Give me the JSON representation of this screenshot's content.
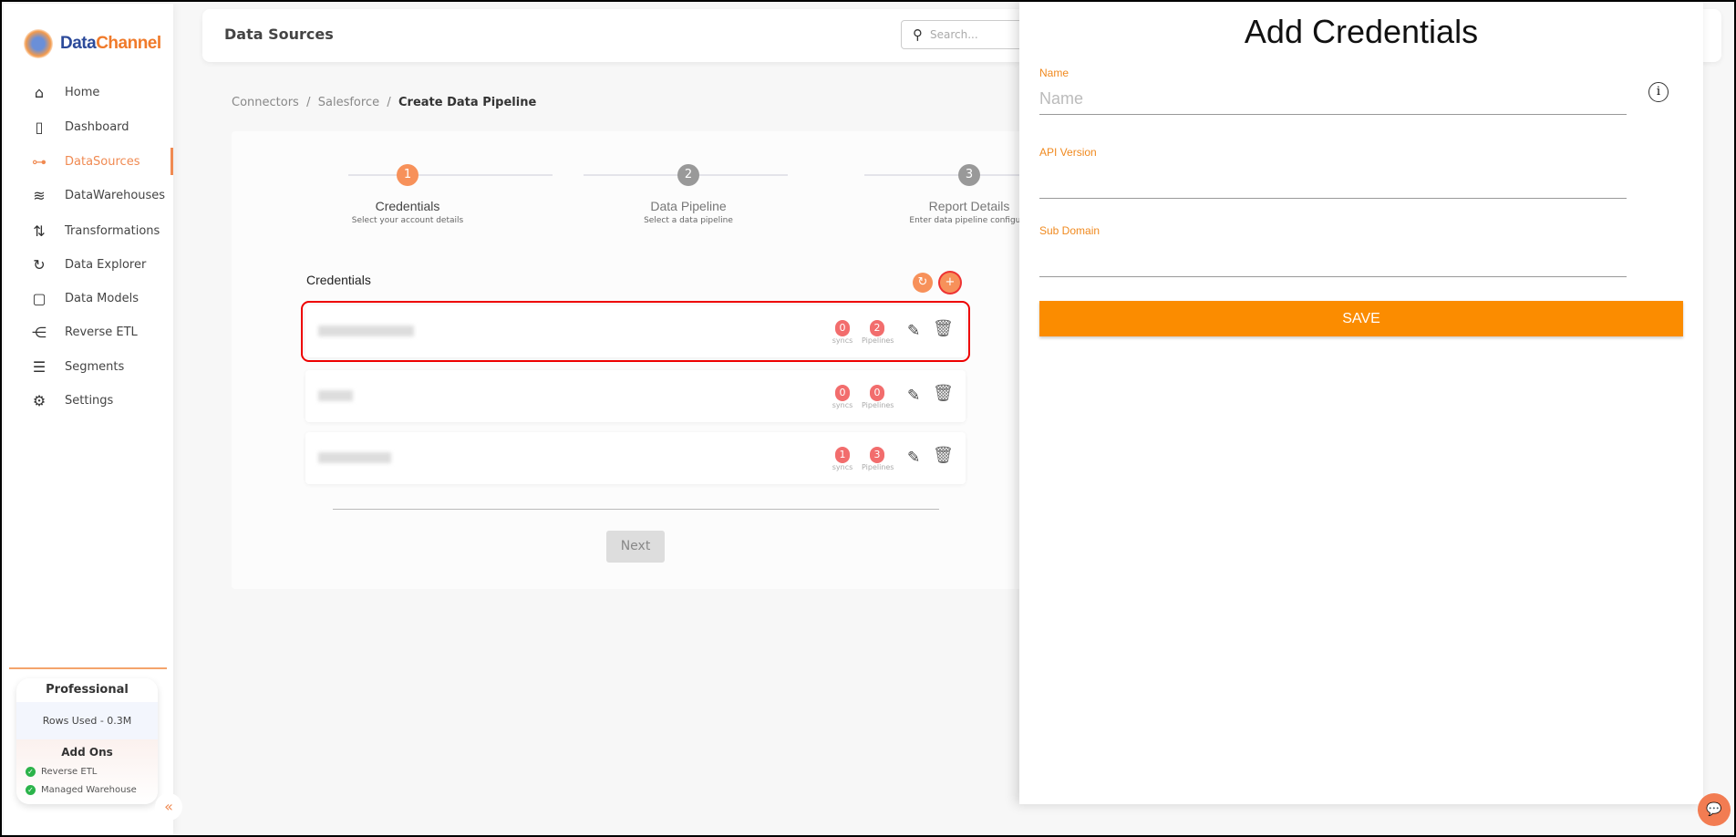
{
  "brand": {
    "part1": "Data",
    "part2": "Channel"
  },
  "sidebar": {
    "items": [
      {
        "label": "Home",
        "icon": "home-icon",
        "glyph": "⌂"
      },
      {
        "label": "Dashboard",
        "icon": "dashboard-icon",
        "glyph": "▯"
      },
      {
        "label": "DataSources",
        "icon": "datasources-icon",
        "glyph": "⊶",
        "active": true
      },
      {
        "label": "DataWarehouses",
        "icon": "layers-icon",
        "glyph": "≋"
      },
      {
        "label": "Transformations",
        "icon": "transform-icon",
        "glyph": "⇅"
      },
      {
        "label": "Data Explorer",
        "icon": "explorer-icon",
        "glyph": "↻"
      },
      {
        "label": "Data Models",
        "icon": "models-icon",
        "glyph": "▢"
      },
      {
        "label": "Reverse ETL",
        "icon": "reverse-etl-icon",
        "glyph": "⋲"
      },
      {
        "label": "Segments",
        "icon": "segments-icon",
        "glyph": "☰"
      },
      {
        "label": "Settings",
        "icon": "gear-icon",
        "glyph": "⚙"
      }
    ]
  },
  "plan": {
    "name": "Professional",
    "rows_used": "Rows Used - 0.3M",
    "addons_title": "Add Ons",
    "addons": [
      "Reverse ETL",
      "Managed Warehouse"
    ]
  },
  "header": {
    "title": "Data Sources",
    "search_placeholder": "Search..."
  },
  "breadcrumb": [
    "Connectors",
    "Salesforce",
    "Create Data Pipeline"
  ],
  "steps": [
    {
      "num": "1",
      "name": "Credentials",
      "sub": "Select your account details"
    },
    {
      "num": "2",
      "name": "Data Pipeline",
      "sub": "Select a data pipeline"
    },
    {
      "num": "3",
      "name": "Report Details",
      "sub": "Enter data pipeline configura"
    }
  ],
  "credentials": {
    "title": "Credentials",
    "rows": [
      {
        "syncs": "0",
        "pipelines": "2"
      },
      {
        "syncs": "0",
        "pipelines": "0"
      },
      {
        "syncs": "1",
        "pipelines": "3"
      }
    ],
    "syncs_label": "syncs",
    "pipelines_label": "Pipelines",
    "next_label": "Next"
  },
  "panel": {
    "title": "Add Credentials",
    "fields": [
      {
        "label": "Name",
        "placeholder": "Name",
        "value": ""
      },
      {
        "label": "API Version",
        "placeholder": "",
        "value": ""
      },
      {
        "label": "Sub Domain",
        "placeholder": "",
        "value": ""
      }
    ],
    "save_label": "SAVE"
  },
  "colors": {
    "accent": "#f7915a",
    "save": "#fb8c00",
    "badge": "#f26d6d",
    "label": "#f08a20"
  }
}
